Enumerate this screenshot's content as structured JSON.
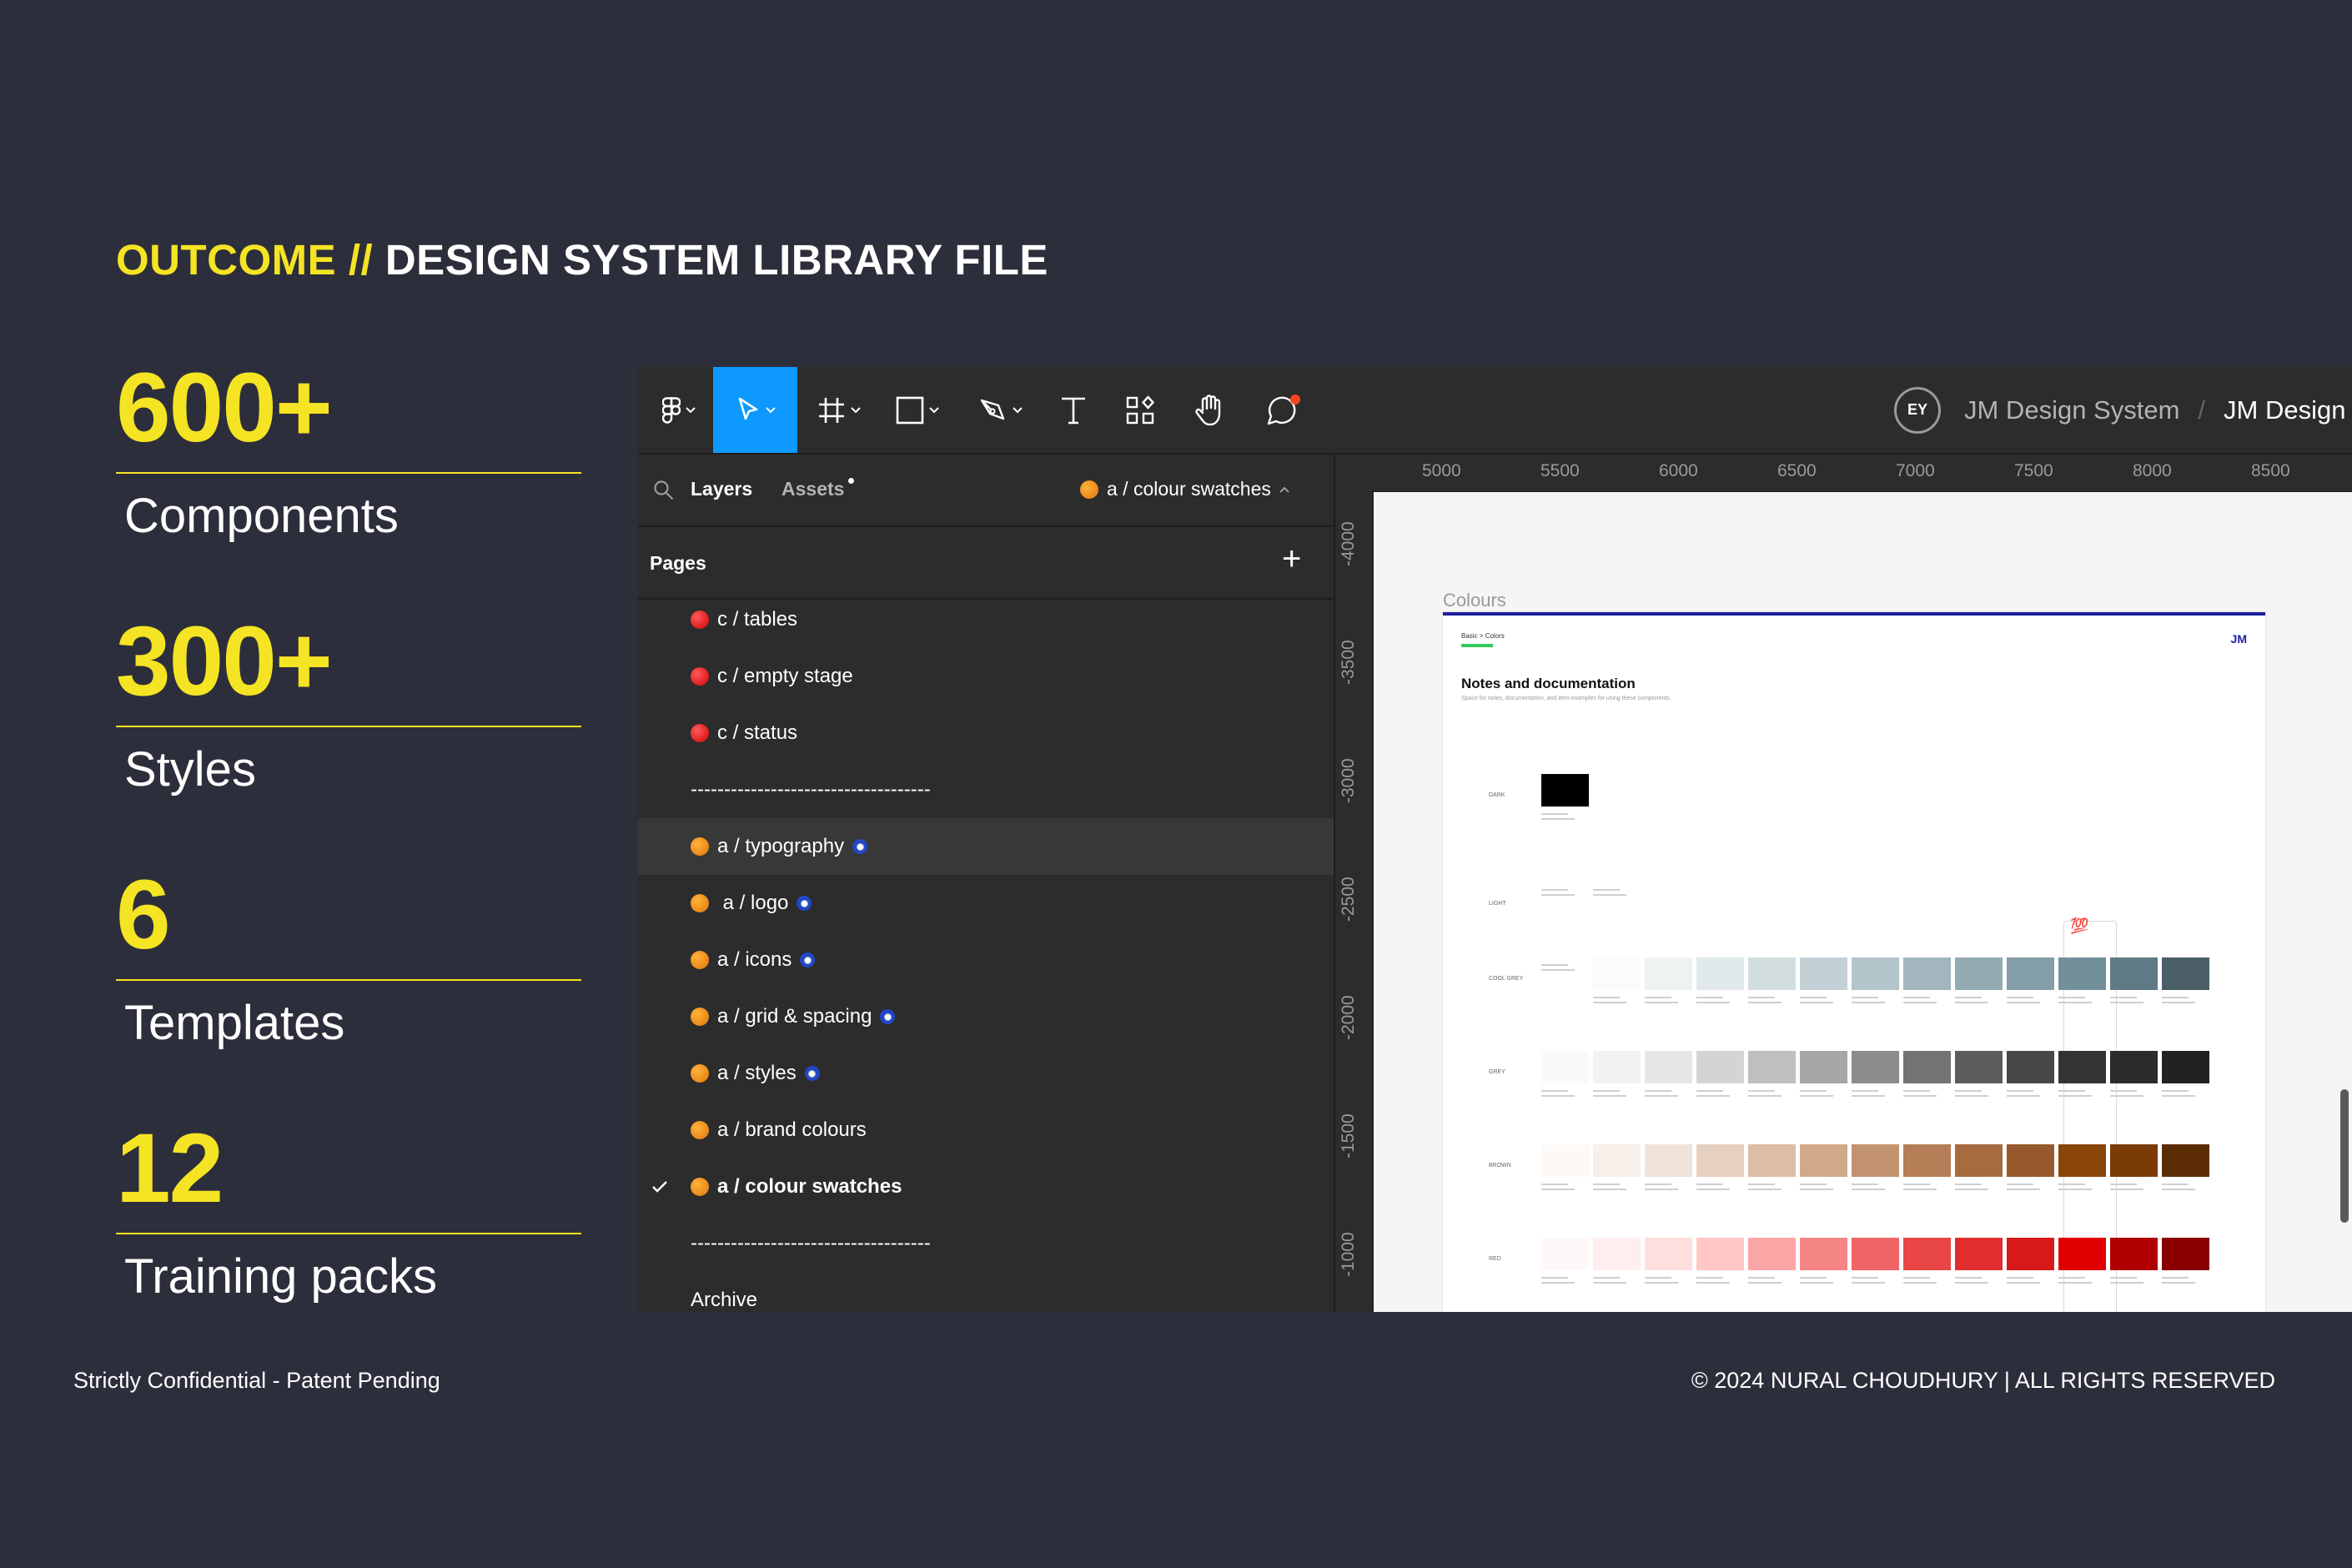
{
  "heading": {
    "highlight": "OUTCOME //",
    "title": "DESIGN SYSTEM LIBRARY FILE"
  },
  "stats": [
    {
      "value": "600+",
      "label": "Components"
    },
    {
      "value": "300+",
      "label": "Styles"
    },
    {
      "value": "6",
      "label": "Templates"
    },
    {
      "value": "12",
      "label": "Training packs"
    }
  ],
  "footer": {
    "left": "Strictly Confidential - Patent Pending",
    "right": "© 2024 NURAL CHOUDHURY | ALL RIGHTS RESERVED"
  },
  "figma": {
    "breadcrumb": {
      "badge": "EY",
      "team": "JM Design System",
      "separator": "/",
      "file": "JM Design System"
    },
    "tabs": {
      "layers": "Layers",
      "assets": "Assets",
      "current_page": "a / colour swatches"
    },
    "pages_header": "Pages",
    "add_icon": "+",
    "pages": [
      {
        "label": "c / tables",
        "dot": "red",
        "badge": false
      },
      {
        "label": "c / empty stage",
        "dot": "red",
        "badge": false
      },
      {
        "label": "c / status",
        "dot": "red",
        "badge": false
      },
      {
        "label": "------------------------------------",
        "dot": "none",
        "badge": false
      },
      {
        "label": "a / typography",
        "dot": "orange",
        "badge": true,
        "hover": true
      },
      {
        "label": " a / logo",
        "dot": "orange",
        "badge": true
      },
      {
        "label": "a / icons",
        "dot": "orange",
        "badge": true
      },
      {
        "label": "a / grid & spacing",
        "dot": "orange",
        "badge": true
      },
      {
        "label": "a / styles",
        "dot": "orange",
        "badge": true
      },
      {
        "label": "a / brand colours",
        "dot": "orange",
        "badge": false
      },
      {
        "label": "a / colour swatches",
        "dot": "orange",
        "badge": false,
        "selected": true
      },
      {
        "label": "------------------------------------",
        "dot": "none",
        "badge": false
      },
      {
        "label": "Archive",
        "dot": "none",
        "badge": false
      }
    ],
    "hruler_ticks": [
      "5000",
      "5500",
      "6000",
      "6500",
      "7000",
      "7500",
      "8000",
      "8500"
    ],
    "vruler_ticks": [
      "-4000",
      "-3500",
      "-3000",
      "-2500",
      "-2000",
      "-1500",
      "-1000"
    ],
    "canvas": {
      "frame_title": "Colours",
      "frame_breadcrumb": "Basic  >  Colors",
      "frame_logo": "JM",
      "frame_heading": "Notes and documentation",
      "frame_subheading": "Space for notes, documentation, and item-examples for using these components.",
      "emoji": "💯",
      "rows": [
        {
          "label": "DARK",
          "colors": [
            "#000000"
          ]
        },
        {
          "label": "LIGHT",
          "colors": [
            "#ffffff",
            "#ffffff"
          ]
        },
        {
          "label": "COOL GREY",
          "colors": [
            "#ffffff",
            "#fafbfb",
            "#eef2f2",
            "#e1e8ea",
            "#d2dde0",
            "#c3d1d6",
            "#b3c4ca",
            "#a2b6be",
            "#93aab3",
            "#839ea8",
            "#72909b",
            "#5f7a85",
            "#4a5e66"
          ]
        },
        {
          "label": "GREY",
          "colors": [
            "#fafafa",
            "#f2f2f2",
            "#e6e6e6",
            "#d4d4d4",
            "#bfbfbf",
            "#a6a6a6",
            "#8c8c8c",
            "#737373",
            "#5c5c5c",
            "#474747",
            "#333333",
            "#2b2b2b",
            "#222222"
          ]
        },
        {
          "label": "BROWN",
          "colors": [
            "#fcf9f7",
            "#f6efea",
            "#efe2d9",
            "#e6d0c0",
            "#dcbda6",
            "#d0a98a",
            "#c39370",
            "#b57e56",
            "#a66c3f",
            "#96592b",
            "#8a4508",
            "#7a3b06",
            "#5c2d05"
          ]
        },
        {
          "label": "RED",
          "colors": [
            "#fff8f8",
            "#ffeeee",
            "#ffdede",
            "#ffc6c6",
            "#fba6a6",
            "#f68585",
            "#ef6464",
            "#e84646",
            "#e02d2d",
            "#d91919",
            "#e00000",
            "#b00000",
            "#8a0000"
          ]
        }
      ]
    }
  }
}
